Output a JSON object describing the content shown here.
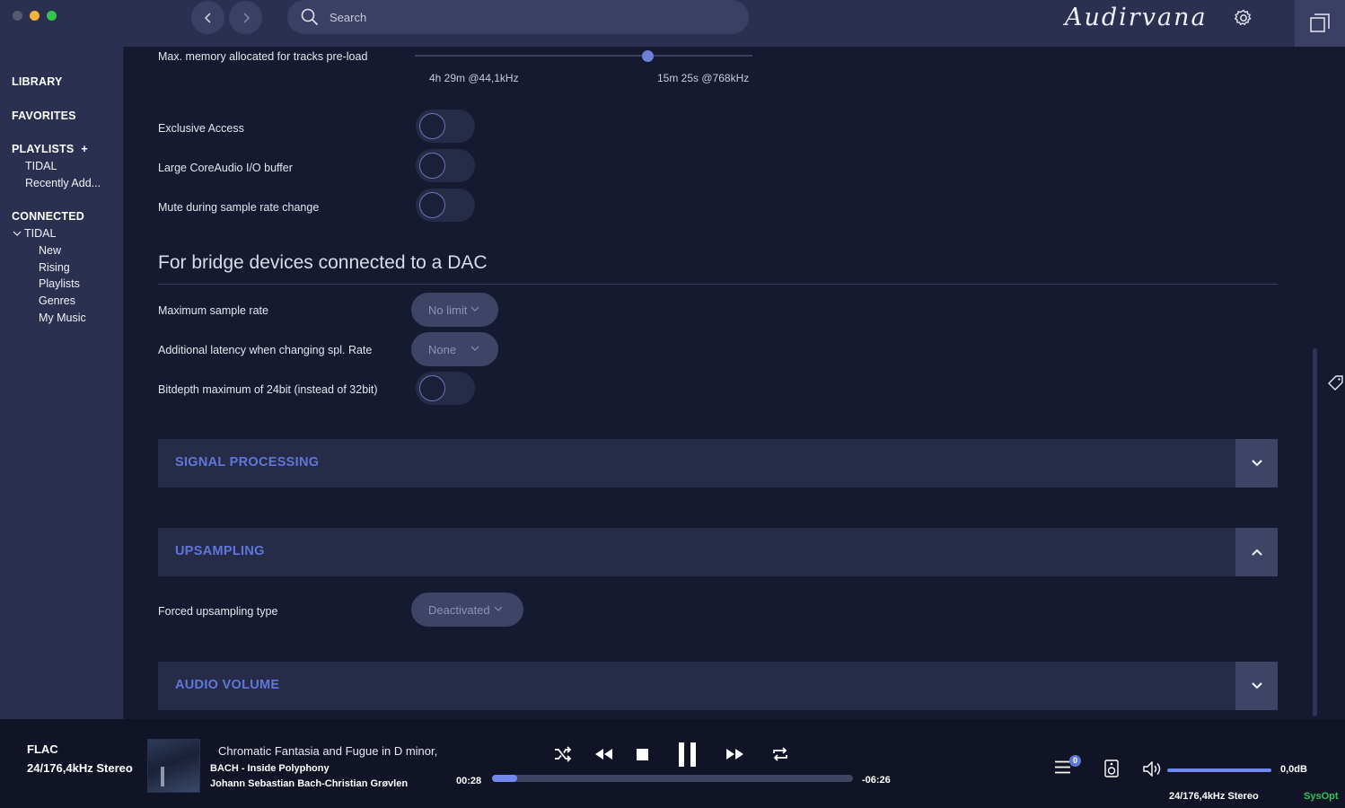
{
  "app": {
    "logo_text": "Audirvana"
  },
  "search": {
    "placeholder": "Search"
  },
  "sidebar": {
    "library": "LIBRARY",
    "favorites": "FAVORITES",
    "playlists": {
      "label": "PLAYLISTS",
      "plus": "+",
      "items": [
        "TIDAL",
        "Recently Add..."
      ]
    },
    "connected": {
      "label": "CONNECTED",
      "service": "TIDAL",
      "items": [
        "New",
        "Rising",
        "Playlists",
        "Genres",
        "My Music"
      ]
    }
  },
  "settings": {
    "memory": {
      "label": "Max. memory allocated for tracks pre-load",
      "min_label": "4h 29m @44,1kHz",
      "max_label": "15m 25s @768kHz",
      "position_fraction": 0.69
    },
    "toggles": [
      {
        "label": "Exclusive Access",
        "on": false
      },
      {
        "label": "Large CoreAudio I/O buffer",
        "on": false
      },
      {
        "label": "Mute during sample rate change",
        "on": false
      }
    ],
    "bridge": {
      "title": "For bridge devices connected to a DAC",
      "max_rate": {
        "label": "Maximum sample rate",
        "value": "No limit"
      },
      "latency": {
        "label": "Additional latency when changing spl. Rate",
        "value": "None"
      },
      "bitdepth": {
        "label": "Bitdepth maximum of 24bit (instead of 32bit)",
        "on": false
      }
    },
    "panels": {
      "signal": "SIGNAL PROCESSING",
      "upsampling": "UPSAMPLING",
      "audio_volume": "AUDIO VOLUME"
    },
    "upsampling": {
      "label": "Forced upsampling type",
      "value": "Deactivated"
    }
  },
  "player": {
    "format": "FLAC",
    "format_detail": "24/176,4kHz Stereo",
    "title": "Chromatic Fantasia and Fugue in D minor,",
    "album": "BACH - Inside Polyphony",
    "artist": "Johann Sebastian Bach-Christian Grøvlen",
    "elapsed": "00:28",
    "remaining": "-06:26",
    "progress_fraction": 0.07,
    "queue_count": "0",
    "volume": "0,0dB",
    "output_format": "24/176,4kHz Stereo",
    "sysopt": "SysOpt"
  },
  "colors": {
    "accent": "#5f77d9",
    "sysopt": "#33c25a"
  }
}
